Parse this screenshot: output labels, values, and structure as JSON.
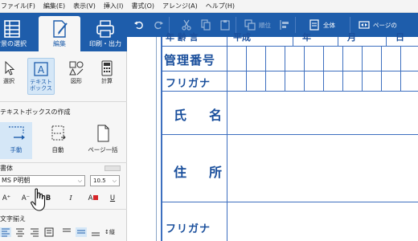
{
  "menubar": {
    "items": [
      "ファイル(F)",
      "編集(E)",
      "表示(V)",
      "挿入(I)",
      "書式(O)",
      "アレンジ(A)",
      "ヘルプ(H)"
    ]
  },
  "ribbon": {
    "tabs": [
      {
        "label": "背景の選択",
        "icon": "layout-icon"
      },
      {
        "label": "編集",
        "icon": "edit-pen-icon",
        "active": true
      },
      {
        "label": "印刷・出力",
        "icon": "printer-icon"
      }
    ]
  },
  "toolbar": {
    "undo_icon": "undo-icon",
    "redo_icon": "redo-icon",
    "cut_icon": "cut-icon",
    "copy_icon": "copy-icon",
    "paste_icon": "paste-icon",
    "order_label": "順位",
    "align_icon": "align-icon",
    "fit_all_label": "全体",
    "page_width_label": "ページの"
  },
  "tools": [
    {
      "label": "選択",
      "icon": "arrow-cursor-icon"
    },
    {
      "label": "テキスト\nボックス",
      "icon": "textbox-icon",
      "active": true
    },
    {
      "label": "図形",
      "icon": "shapes-icon"
    },
    {
      "label": "計算",
      "icon": "calculator-icon"
    }
  ],
  "textbox_section": {
    "title": "テキストボックスの作成",
    "buttons": [
      {
        "label": "手動",
        "icon": "manual-textbox-icon",
        "active": true
      },
      {
        "label": "自動",
        "icon": "auto-textbox-icon"
      },
      {
        "label": "ページ一括",
        "icon": "page-icon"
      }
    ]
  },
  "font_section": {
    "title": "書体",
    "font_name": "MS P明朝",
    "font_size": "10.5",
    "format_buttons": [
      "A⁺",
      "A⁻",
      "B",
      "I",
      "A",
      "U"
    ]
  },
  "align_section": {
    "title": "文字揃え",
    "vertical_label": "↕縦"
  },
  "document": {
    "top_cutoff": "年 齢 言",
    "top_cutoff_2": "平成",
    "top_cutoff_3": "年",
    "top_cutoff_4": "月",
    "top_cutoff_5": "日",
    "rows": [
      {
        "label": "管理番号"
      },
      {
        "label": "フリガナ"
      },
      {
        "label": "氏　名"
      },
      {
        "label": "住　所"
      },
      {
        "label": "フリガナ"
      }
    ]
  },
  "colors": {
    "ribbon_blue": "#1e5dab",
    "form_blue": "#3d6fbf",
    "active_bg": "#d5e7f7"
  }
}
